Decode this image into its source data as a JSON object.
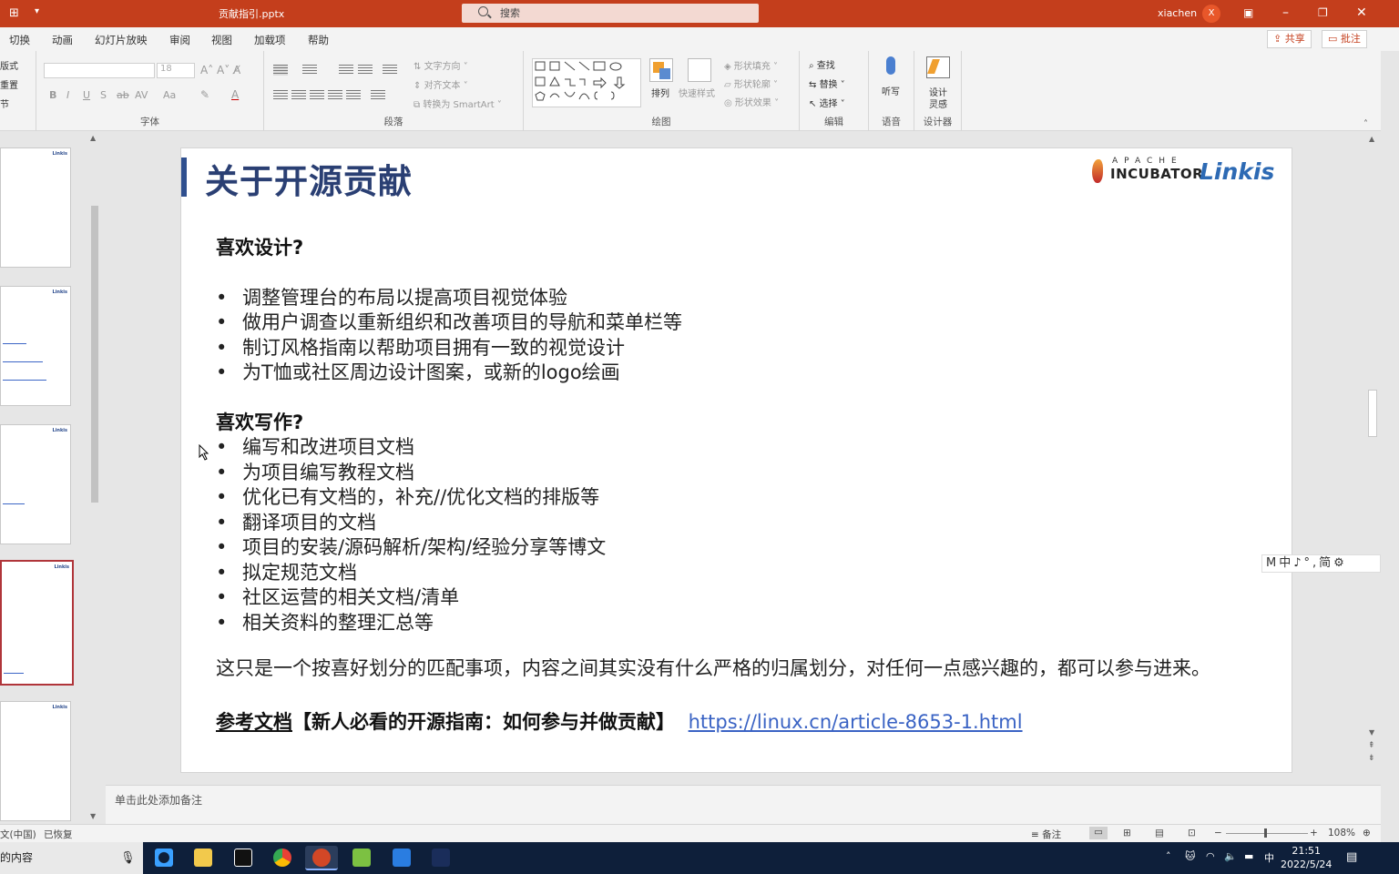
{
  "titlebar": {
    "file_name": "贡献指引.pptx",
    "search_placeholder": "搜索",
    "user_name": "xiachen",
    "user_initial": "X"
  },
  "menu_tabs": [
    "切换",
    "动画",
    "幻灯片放映",
    "审阅",
    "视图",
    "加载项",
    "帮助"
  ],
  "share_label": "共享",
  "comment_label": "批注",
  "ribbon": {
    "left_cut": [
      "版式",
      "重置",
      "节"
    ],
    "font_group": "字体",
    "font_size": "18",
    "para_group": "段落",
    "text_direction": "文字方向",
    "align_text": "对齐文本",
    "convert_smartart": "转换为 SmartArt",
    "draw_group": "绘图",
    "arrange": "排列",
    "quick_styles": "快速样式",
    "shape_fill": "形状填充",
    "shape_outline": "形状轮廓",
    "shape_effects": "形状效果",
    "edit_group": "编辑",
    "find": "查找",
    "replace": "替换",
    "select": "选择",
    "voice_group": "语音",
    "dictate": "听写",
    "designer_group": "设计器",
    "design_ideas_1": "设计",
    "design_ideas_2": "灵感"
  },
  "slide": {
    "title": "关于开源贡献",
    "logo": {
      "apache": "APACHE",
      "incubator": "INCUBATOR",
      "linkis": "Linkis"
    },
    "section1_heading": "喜欢设计?",
    "section1_items": [
      "调整管理台的布局以提高项目视觉体验",
      "做用户调查以重新组织和改善项目的导航和菜单栏等",
      "制订风格指南以帮助项目拥有一致的视觉设计",
      "为T恤或社区周边设计图案，或新的logo绘画"
    ],
    "section2_heading": "喜欢写作?",
    "section2_items": [
      "编写和改进项目文档",
      "为项目编写教程文档",
      "优化已有文档的，补充//优化文档的排版等",
      "翻译项目的文档",
      "项目的安装/源码解析/架构/经验分享等博文",
      "拟定规范文档",
      "社区运营的相关文档/清单",
      "相关资料的整理汇总等"
    ],
    "note_paragraph": "这只是一个按喜好划分的匹配事项，内容之间其实没有什么严格的归属划分，对任何一点感兴趣的，都可以参与进来。",
    "ref_label": "参考文档",
    "ref_title": "【新人必看的开源指南：如何参与并做贡献】",
    "ref_url": "https://linux.cn/article-8653-1.html"
  },
  "ime_bar": "M中♪°,简⚙",
  "notes_placeholder": "单击此处添加备注",
  "statusbar": {
    "language": "文(中国)",
    "recovered": "已恢复",
    "notes": "备注",
    "zoom": "108%"
  },
  "taskbar": {
    "search_text": "的内容",
    "time": "21:51",
    "date": "2022/5/24",
    "ime": "中"
  }
}
